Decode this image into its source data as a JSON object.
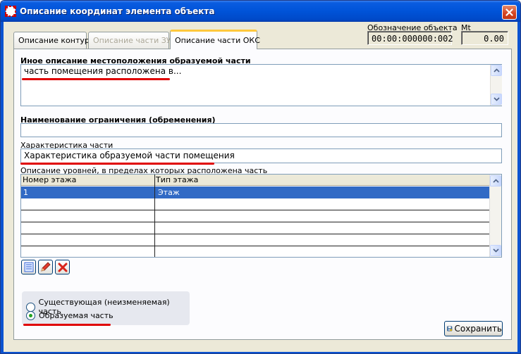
{
  "window": {
    "title": "Описание координат элемента объекта"
  },
  "tabs": [
    {
      "label": "Описание контура",
      "state": "normal"
    },
    {
      "label": "Описание части ЗУ",
      "state": "disabled"
    },
    {
      "label": "Описание части ОКС",
      "state": "active"
    }
  ],
  "header": {
    "object_label": "Обозначение объекта",
    "object_value": "00:00:000000:002",
    "mt_label": "Mt",
    "mt_value": "0.00"
  },
  "form": {
    "location_label": "Иное описание местоположения образуемой части",
    "location_value": "часть помещения расположена в...",
    "restriction_label": "Наименование ограничения (обременения)",
    "restriction_value": "",
    "characteristic_label": "Характеристика части",
    "characteristic_value": "Характеристика образуемой части помещения",
    "levels_label": "Описание уровней, в пределах которых расположена часть"
  },
  "grid": {
    "columns": [
      "Номер этажа",
      "Тип этажа"
    ],
    "rows": [
      {
        "floor_number": "1",
        "floor_type": "Этаж"
      }
    ]
  },
  "radio_group": {
    "options": [
      {
        "label": "Существующая (неизменяемая) часть",
        "selected": false
      },
      {
        "label": "Образуемая часть",
        "selected": true
      }
    ]
  },
  "buttons": {
    "save_label": "Сохранить"
  },
  "icons": {
    "app": "app-frame-icon",
    "close": "close-icon",
    "add": "add-record-icon",
    "edit": "edit-pencil-icon",
    "delete": "delete-x-icon",
    "save": "save-disk-icon"
  },
  "colors": {
    "title_bar": "#0053d8",
    "selection": "#316ac5",
    "annotation_red": "#e00000"
  }
}
